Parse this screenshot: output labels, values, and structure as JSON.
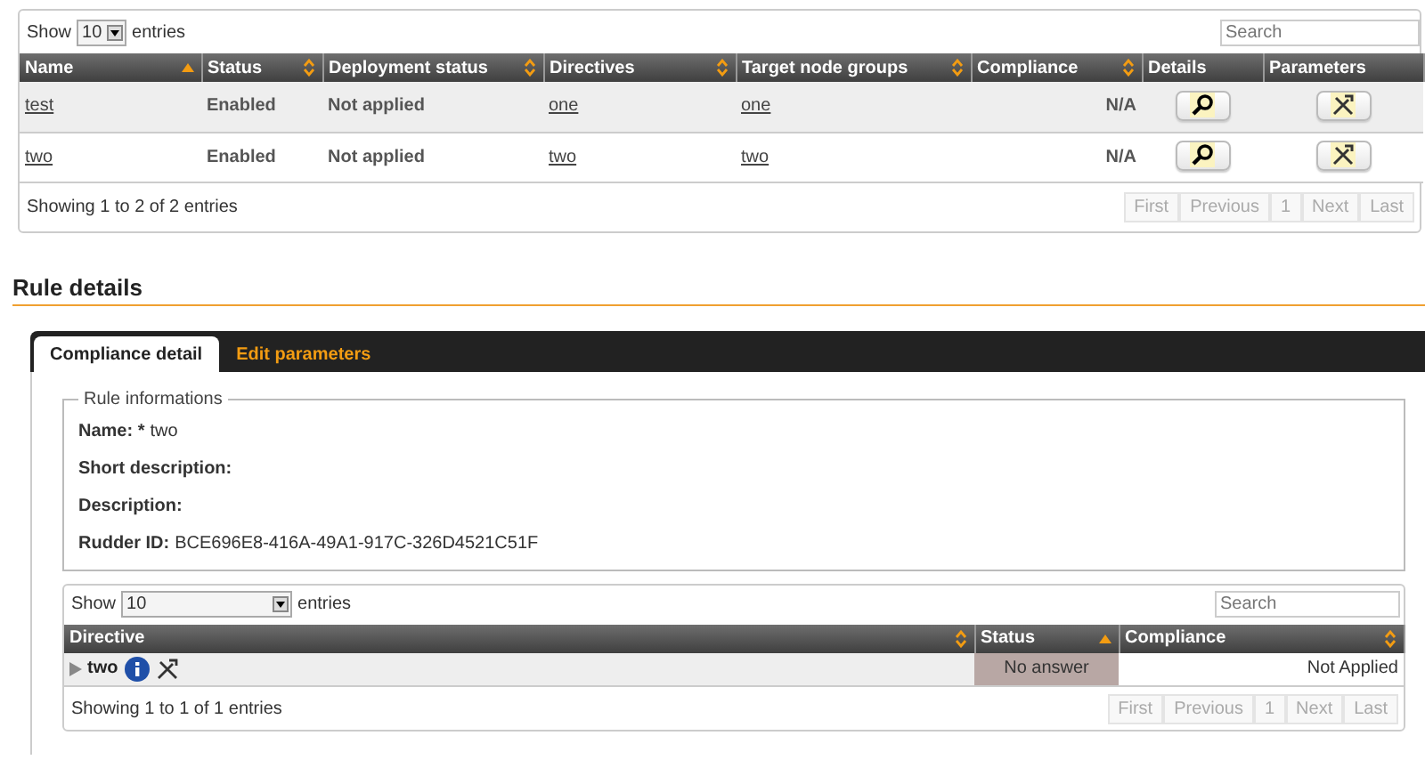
{
  "rules_table": {
    "length": {
      "before": "Show",
      "value": "10",
      "after": "entries"
    },
    "search": {
      "placeholder": "Search"
    },
    "columns": [
      {
        "label": "Name",
        "sorted": true
      },
      {
        "label": "Status",
        "sortable": true,
        "sorted": false
      },
      {
        "label": "Deployment status",
        "sortable": true,
        "sorted": false
      },
      {
        "label": "Directives",
        "sortable": true,
        "sorted": false
      },
      {
        "label": "Target node groups",
        "sortable": true,
        "sorted": false
      },
      {
        "label": "Compliance",
        "sortable": true,
        "sorted": false
      },
      {
        "label": "Details",
        "sortable": false
      },
      {
        "label": "Parameters",
        "sortable": false
      }
    ],
    "rows": [
      {
        "name": "test",
        "status": "Enabled",
        "deployment_status": "Not applied",
        "directives": "one",
        "target_node_groups": "one",
        "compliance": "N/A"
      },
      {
        "name": "two",
        "status": "Enabled",
        "deployment_status": "Not applied",
        "directives": "two",
        "target_node_groups": "two",
        "compliance": "N/A"
      }
    ],
    "info": "Showing 1 to 2 of 2 entries",
    "pagination": [
      {
        "label": "First",
        "disabled": true
      },
      {
        "label": "Previous",
        "disabled": true
      },
      {
        "label": "1",
        "disabled": true
      },
      {
        "label": "Next",
        "disabled": true
      },
      {
        "label": "Last",
        "disabled": true
      }
    ]
  },
  "rule_details": {
    "title": "Rule details",
    "tabs": [
      {
        "label": "Compliance detail",
        "selected": true
      },
      {
        "label": "Edit parameters",
        "selected": false
      }
    ],
    "rule_info": {
      "legend": "Rule informations",
      "fields": [
        {
          "label": "Name: *",
          "value": "two"
        },
        {
          "label": "Short description:"
        },
        {
          "label": "Description:"
        },
        {
          "label": "Rudder ID:",
          "value": "BCE696E8-416A-49A1-917C-326D4521C51F"
        }
      ]
    },
    "directives_table": {
      "length": {
        "before": "Show",
        "value": "10",
        "after": "entries"
      },
      "search": {
        "placeholder": "Search"
      },
      "columns": [
        {
          "label": "Directive",
          "sortable": true,
          "sorted": false
        },
        {
          "label": "Status",
          "sorted": true
        },
        {
          "label": "Compliance",
          "sortable": true,
          "sorted": false
        }
      ],
      "rows": [
        {
          "directive": "two",
          "status": "No answer",
          "compliance": "Not Applied"
        }
      ],
      "info": "Showing 1 to 1 of 1 entries",
      "pagination": [
        {
          "label": "First",
          "disabled": true
        },
        {
          "label": "Previous",
          "disabled": true
        },
        {
          "label": "1",
          "disabled": true
        },
        {
          "label": "Next",
          "disabled": true
        },
        {
          "label": "Last",
          "disabled": true
        }
      ]
    }
  }
}
